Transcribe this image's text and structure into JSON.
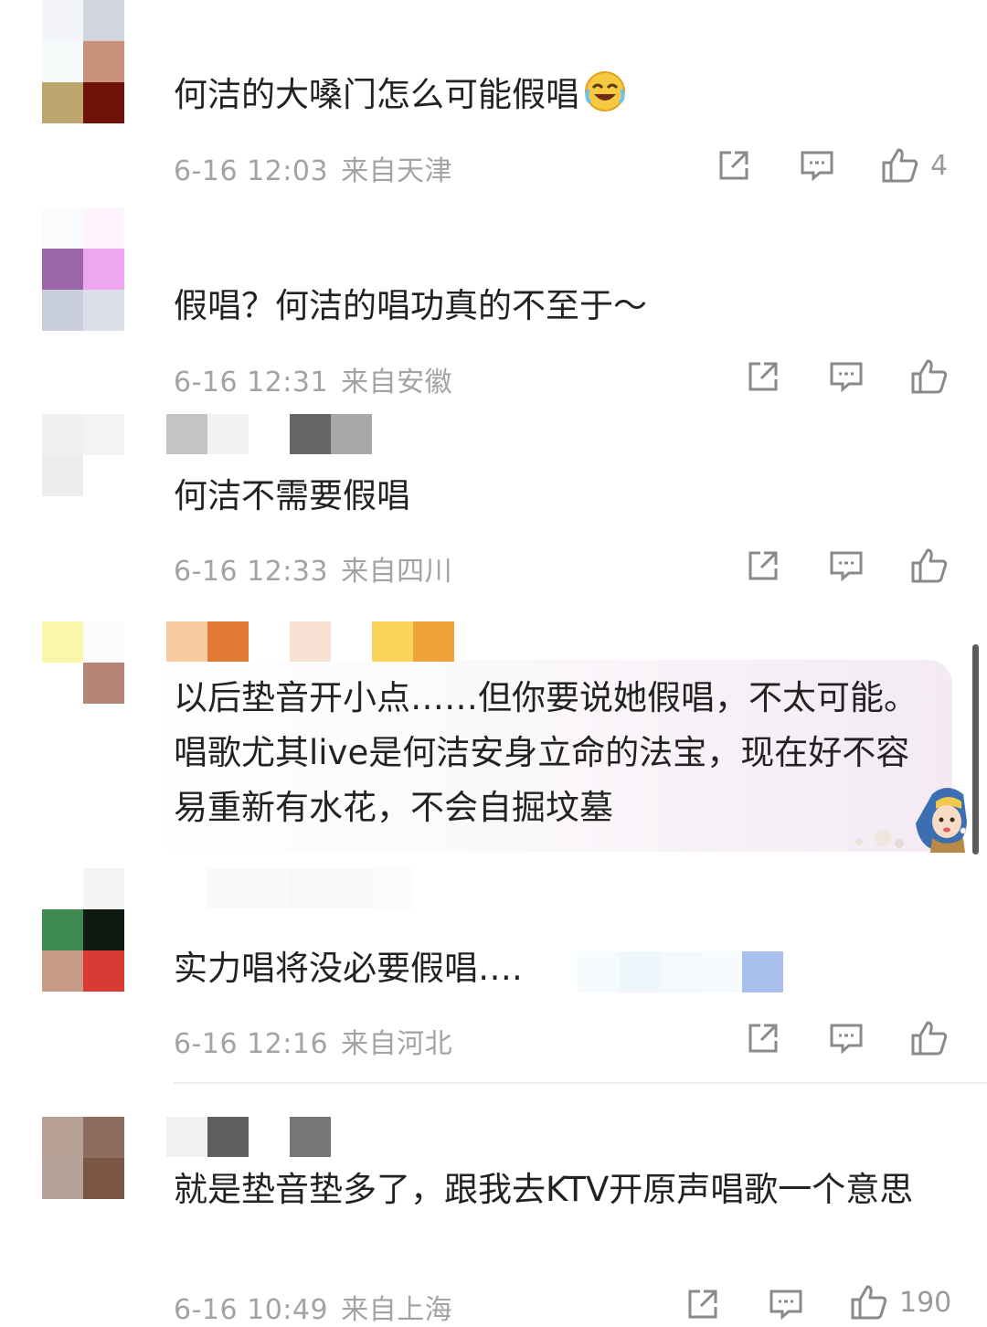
{
  "comments": [
    {
      "text": "何洁的大嗓门怎么可能假唱",
      "emoji": "laughing-crying-emoji",
      "date": "6-16 12:03",
      "location": "来自天津",
      "likes": "4"
    },
    {
      "text": "假唱？何洁的唱功真的不至于～",
      "date": "6-16 12:31",
      "location": "来自安徽",
      "likes": ""
    },
    {
      "text": "何洁不需要假唱",
      "date": "6-16 12:33",
      "location": "来自四川",
      "likes": ""
    },
    {
      "text": "以后垫音开小点……但你要说她假唱，不太可能。唱歌尤其live是何洁安身立命的法宝，现在好不容易重新有水花，不会自掘坟墓",
      "decoration": "girl-with-pearl-earring-sticker"
    },
    {
      "text": "实力唱将没必要假唱….",
      "date": "6-16 12:16",
      "location": "来自河北",
      "likes": ""
    },
    {
      "text": "就是垫音垫多了，跟我去KTV开原声唱歌一个意思",
      "date": "6-16 10:49",
      "location": "来自上海",
      "likes": "190"
    }
  ],
  "icons": {
    "share": "share-icon",
    "reply": "comment-icon",
    "like": "thumbs-up-icon"
  },
  "colors": {
    "meta": "#a3a3a3",
    "text": "#222222",
    "scrollbar": "#5b5b5b"
  }
}
